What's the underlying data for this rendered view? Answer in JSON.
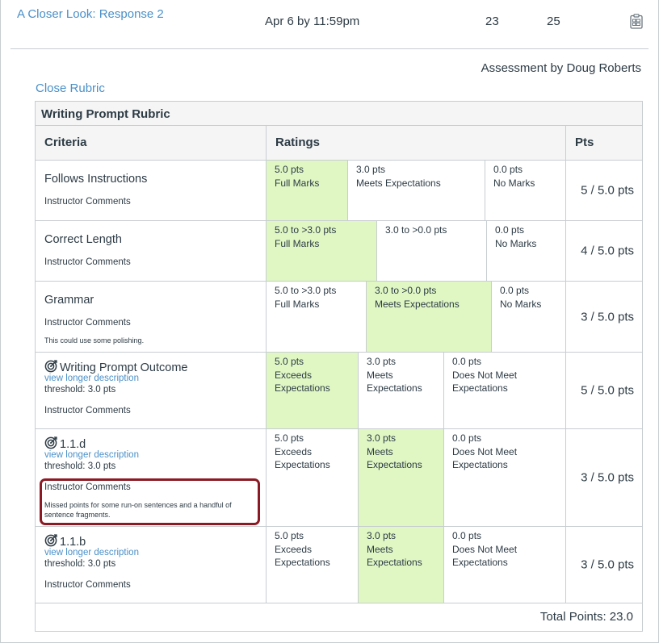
{
  "assignment": {
    "title": "A Closer Look: Response 2",
    "due": "Apr 6 by 11:59pm",
    "score": "23",
    "possible": "25",
    "rubric_icon": "rubric-icon"
  },
  "assessor": "Assessment by Doug Roberts",
  "close_rubric": "Close Rubric",
  "rubric": {
    "title": "Writing Prompt Rubric",
    "headers": {
      "criteria": "Criteria",
      "ratings": "Ratings",
      "pts": "Pts"
    },
    "total": "Total Points: 23.0",
    "criteria": [
      {
        "name": "Follows Instructions",
        "instructor_comments_label": "Instructor Comments",
        "comment": "",
        "points": "5 / 5.0 pts",
        "ratings": [
          {
            "pts": "5.0 pts",
            "desc": "Full Marks",
            "selected": true
          },
          {
            "pts": "3.0 pts",
            "desc": "Meets Expectations",
            "selected": false
          },
          {
            "pts": "0.0 pts",
            "desc": "No Marks",
            "selected": false
          }
        ]
      },
      {
        "name": "Correct Length",
        "instructor_comments_label": "Instructor Comments",
        "comment": "",
        "points": "4 / 5.0 pts",
        "ratings": [
          {
            "pts": "5.0 to >3.0 pts",
            "desc": "Full Marks",
            "selected": true
          },
          {
            "pts": "3.0 to >0.0 pts",
            "desc": "",
            "selected": false
          },
          {
            "pts": "0.0 pts",
            "desc": "No Marks",
            "selected": false
          }
        ]
      },
      {
        "name": "Grammar",
        "instructor_comments_label": "Instructor Comments",
        "comment": "This could use some polishing.",
        "points": "3 / 5.0 pts",
        "ratings": [
          {
            "pts": "5.0 to >3.0 pts",
            "desc": "Full Marks",
            "selected": false
          },
          {
            "pts": "3.0 to >0.0 pts",
            "desc": "Meets Expectations",
            "selected": true
          },
          {
            "pts": "0.0 pts",
            "desc": "No Marks",
            "selected": false
          }
        ]
      },
      {
        "name": "Writing Prompt Outcome",
        "outcome": true,
        "long_desc": "view longer description",
        "threshold": "threshold: 3.0 pts",
        "instructor_comments_label": "Instructor Comments",
        "comment": "",
        "points": "5 / 5.0 pts",
        "ratings": [
          {
            "pts": "5.0 pts",
            "desc": "Exceeds\nExpectations",
            "selected": true
          },
          {
            "pts": "3.0 pts",
            "desc": "Meets\nExpectations",
            "selected": false
          },
          {
            "pts": "0.0 pts",
            "desc": "Does Not Meet\nExpectations",
            "selected": false
          }
        ]
      },
      {
        "name": "1.1.d",
        "outcome": true,
        "long_desc": "view longer description",
        "threshold": "threshold: 3.0 pts",
        "instructor_comments_label": "Instructor Comments",
        "comment": "Missed points for some run-on sentences and a handful of sentence fragments.",
        "points": "3 / 5.0 pts",
        "ratings": [
          {
            "pts": "5.0 pts",
            "desc": "Exceeds\nExpectations",
            "selected": false
          },
          {
            "pts": "3.0 pts",
            "desc": "Meets\nExpectations",
            "selected": true
          },
          {
            "pts": "0.0 pts",
            "desc": "Does Not Meet\nExpectations",
            "selected": false
          }
        ]
      },
      {
        "name": "1.1.b",
        "outcome": true,
        "long_desc": "view longer description",
        "threshold": "threshold: 3.0 pts",
        "instructor_comments_label": "Instructor Comments",
        "comment": "",
        "points": "3 / 5.0 pts",
        "ratings": [
          {
            "pts": "5.0 pts",
            "desc": "Exceeds\nExpectations",
            "selected": false
          },
          {
            "pts": "3.0 pts",
            "desc": "Meets\nExpectations",
            "selected": true
          },
          {
            "pts": "0.0 pts",
            "desc": "Does Not Meet\nExpectations",
            "selected": false
          }
        ]
      }
    ]
  },
  "colors": {
    "link": "#4a90c8",
    "selected_rating": "#e0f7c4",
    "highlight_border": "#8b1a24",
    "text": "#2d3b45"
  }
}
